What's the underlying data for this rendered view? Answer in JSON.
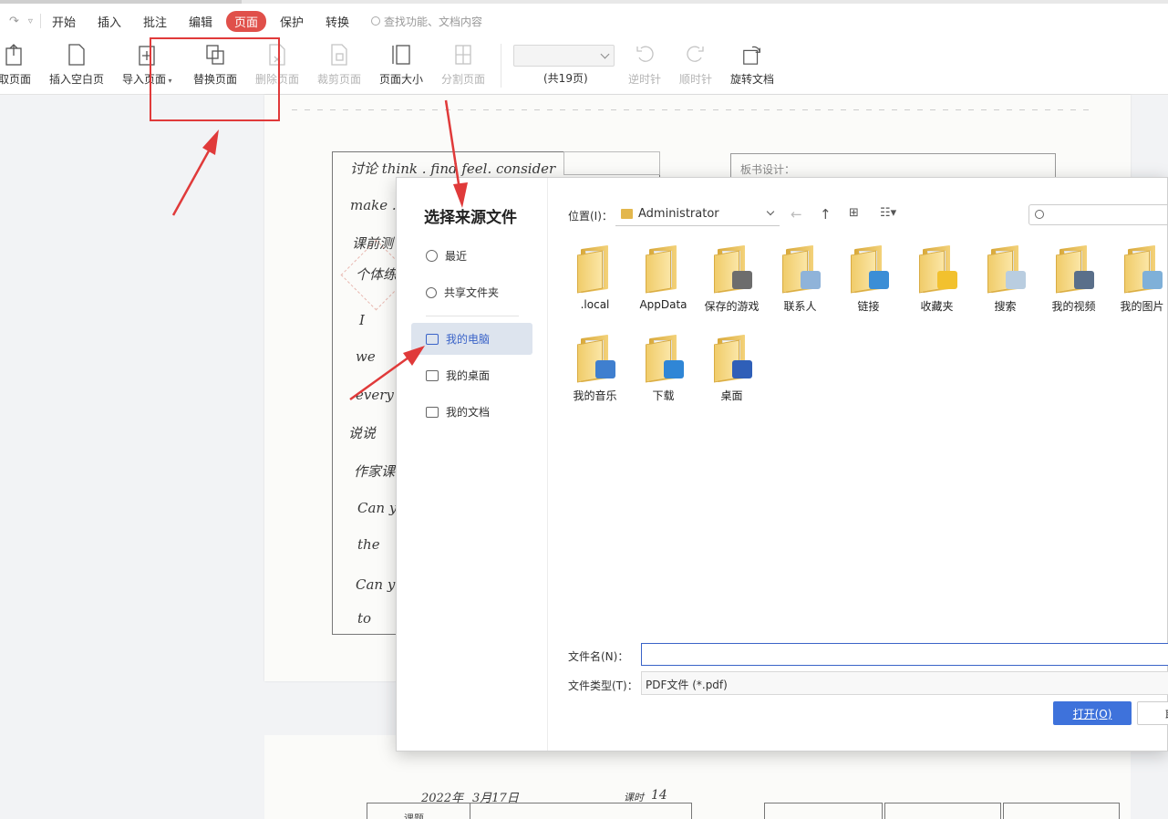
{
  "menubar": {
    "tabs": [
      "开始",
      "插入",
      "批注",
      "编辑",
      "页面",
      "保护",
      "转换"
    ],
    "active_tab": "页面",
    "search_placeholder": "查找功能、文档内容"
  },
  "ribbon": {
    "items": [
      {
        "label": "取页面",
        "disabled": false
      },
      {
        "label": "插入空白页",
        "disabled": false
      },
      {
        "label": "导入页面",
        "disabled": false,
        "has_dropdown": true
      },
      {
        "label": "替换页面",
        "disabled": false
      },
      {
        "label": "删除页面",
        "disabled": true
      },
      {
        "label": "裁剪页面",
        "disabled": true
      },
      {
        "label": "页面大小",
        "disabled": false
      },
      {
        "label": "分割页面",
        "disabled": true
      },
      {
        "label": "逆时针",
        "disabled": true
      },
      {
        "label": "顺时针",
        "disabled": true
      },
      {
        "label": "旋转文档",
        "disabled": false
      }
    ],
    "page_select_value": "",
    "page_count": "(共19页)"
  },
  "document": {
    "page1_lines": [
      "讨论 think . find feel. consider",
      "make .",
      "课前测",
      "个体练",
      "I",
      "we",
      "every",
      "说说",
      "作家课",
      "Can y",
      "the",
      "Can yo",
      "to"
    ],
    "board_label": "板书设计：",
    "page2_header": [
      "2022年",
      "3月17日",
      "课时",
      "14"
    ],
    "page2_col": "课题"
  },
  "dialog": {
    "title": "选择来源文件",
    "nav": [
      {
        "label": "最近",
        "icon": "clock-icon"
      },
      {
        "label": "共享文件夹",
        "icon": "share-icon"
      },
      {
        "label": "我的电脑",
        "icon": "computer-icon",
        "selected": true
      },
      {
        "label": "我的桌面",
        "icon": "desktop-icon"
      },
      {
        "label": "我的文档",
        "icon": "documents-icon"
      }
    ],
    "location_label": "位置(I)：",
    "location_value": "Administrator",
    "search_placeholder": "",
    "folders": [
      {
        "name": ".local",
        "badge": "none"
      },
      {
        "name": "AppData",
        "badge": "none"
      },
      {
        "name": "保存的游戏",
        "badge": "chess"
      },
      {
        "name": "联系人",
        "badge": "contacts"
      },
      {
        "name": "链接",
        "badge": "link"
      },
      {
        "name": "收藏夹",
        "badge": "star"
      },
      {
        "name": "搜索",
        "badge": "search"
      },
      {
        "name": "我的视频",
        "badge": "video"
      },
      {
        "name": "我的图片",
        "badge": "picture"
      },
      {
        "name": "我的音乐",
        "badge": "music"
      },
      {
        "name": "下载",
        "badge": "download"
      },
      {
        "name": "桌面",
        "badge": "desktop"
      }
    ],
    "filename_label": "文件名(N)：",
    "filename_value": "",
    "filetype_label": "文件类型(T)：",
    "filetype_value": "PDF文件 (*.pdf)",
    "open_button": "打开(O)",
    "cancel_button": "取"
  },
  "colors": {
    "accent_red": "#e0504a",
    "primary_blue": "#3e72db",
    "annotation_red": "#e03a3a",
    "folder_yellow": "#f0cc6a"
  }
}
